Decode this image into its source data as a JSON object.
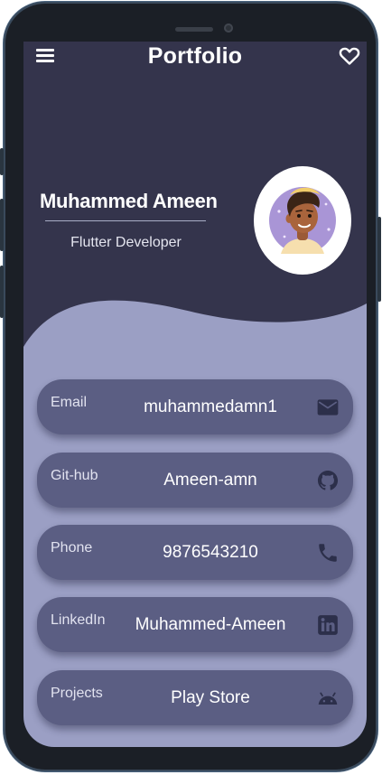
{
  "app": {
    "title": "Portfolio"
  },
  "profile": {
    "name": "Muhammed Ameen",
    "role": "Flutter Developer"
  },
  "contacts": [
    {
      "label": "Email",
      "value": "muhammedamn1",
      "icon": "mail-icon"
    },
    {
      "label": "Git-hub",
      "value": "Ameen-amn",
      "icon": "github-icon"
    },
    {
      "label": "Phone",
      "value": "9876543210",
      "icon": "phone-icon"
    },
    {
      "label": "LinkedIn",
      "value": "Muhammed-Ameen",
      "icon": "linkedin-icon"
    },
    {
      "label": "Projects",
      "value": "Play Store",
      "icon": "android-icon"
    }
  ],
  "colors": {
    "header_background": "#34344c",
    "body_background": "#9b9fc4",
    "card_background": "#5b5e83",
    "text": "#ffffff"
  }
}
